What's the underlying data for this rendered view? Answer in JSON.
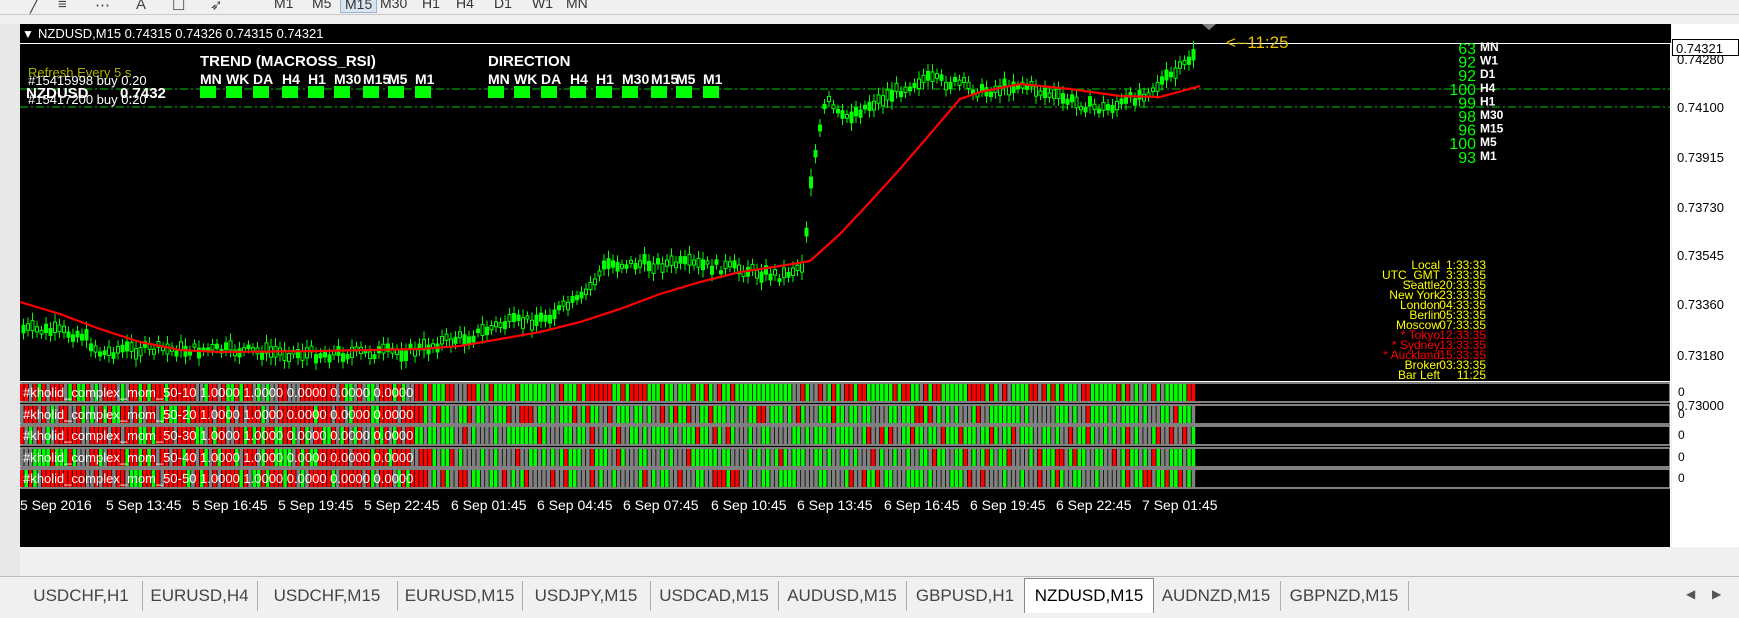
{
  "toolbar": {
    "timeframes": [
      "M1",
      "M5",
      "M15",
      "M30",
      "H1",
      "H4",
      "D1",
      "W1",
      "MN"
    ],
    "active_timeframe": "M15",
    "tool_icons": [
      "line-tool-icon",
      "fibonacci-tool-icon",
      "text-tool-icon",
      "label-tool-icon",
      "arrows-tool-icon"
    ]
  },
  "chart": {
    "header": "NZDUSD,M15  0.74315 0.74326 0.74315 0.74321",
    "current_price": "0.74321",
    "countdown": "<--11:25",
    "overlay": {
      "refresh_text": "Refresh Every 5 s",
      "order1": "#15415998 buy 0.20",
      "order2": "#15417200 buy 0.20",
      "symbol_label": "NZDUSD",
      "symbol_price": "0.7432",
      "trend_title": "TREND (MACROSS_RSI)",
      "direction_title": "DIRECTION",
      "tf_labels": [
        "MN",
        "WK",
        "DA",
        "H4",
        "H1",
        "M30",
        "M15",
        "M5",
        "M1"
      ]
    },
    "strength": [
      {
        "tf": "MN",
        "value": "63"
      },
      {
        "tf": "W1",
        "value": "92"
      },
      {
        "tf": "D1",
        "value": "92"
      },
      {
        "tf": "H4",
        "value": "100"
      },
      {
        "tf": "H1",
        "value": "99"
      },
      {
        "tf": "M30",
        "value": "98"
      },
      {
        "tf": "M15",
        "value": "96"
      },
      {
        "tf": "M5",
        "value": "100"
      },
      {
        "tf": "M1",
        "value": "93"
      }
    ],
    "clocks": [
      {
        "label": "Local",
        "time": "1:33:33",
        "color": "#ffff00"
      },
      {
        "label": "UTC_GMT",
        "time": "3:33:35",
        "color": "#ffff00"
      },
      {
        "label": "Seattle",
        "time": "20:33:35",
        "color": "#ffff00"
      },
      {
        "label": "New York",
        "time": "23:33:35",
        "color": "#ffff00"
      },
      {
        "label": "London",
        "time": "04:33:35",
        "color": "#ffff00"
      },
      {
        "label": "Berlin",
        "time": "05:33:35",
        "color": "#ffff00"
      },
      {
        "label": "Moscow",
        "time": "07:33:35",
        "color": "#ffff00"
      },
      {
        "label": "* Tokyo",
        "time": "12:33:35",
        "color": "#ff0000"
      },
      {
        "label": "* Sydney",
        "time": "13:33:35",
        "color": "#ff0000"
      },
      {
        "label": "* Auckland",
        "time": "15:33:35",
        "color": "#ff0000"
      },
      {
        "label": "Broker",
        "time": "03:33:35",
        "color": "#ffff00"
      },
      {
        "label": "Bar Left",
        "time": "11:25",
        "color": "#ffff00"
      }
    ],
    "price_scale": [
      "0.74280",
      "0.74100",
      "0.73915",
      "0.73730",
      "0.73545",
      "0.73360",
      "0.73180",
      "0.73000"
    ],
    "time_labels": [
      "5 Sep 2016",
      "5 Sep 13:45",
      "5 Sep 16:45",
      "5 Sep 19:45",
      "5 Sep 22:45",
      "6 Sep 01:45",
      "6 Sep 04:45",
      "6 Sep 07:45",
      "6 Sep 10:45",
      "6 Sep 13:45",
      "6 Sep 16:45",
      "6 Sep 19:45",
      "6 Sep 22:45",
      "7 Sep 01:45"
    ],
    "indicators": [
      {
        "label": "#kholid_complex_mom_50-10 1.0000 1.0000 0.0000 0.0000 0.0000",
        "scale": "0"
      },
      {
        "label": "#kholid_complex_mom_50-20 1.0000 1.0000 0.0000 0.0000 0.0000",
        "scale": "0"
      },
      {
        "label": "#kholid_complex_mom_50-30 1.0000 1.0000 0.0000 0.0000 0.0000",
        "scale": "0"
      },
      {
        "label": "#kholid_complex_mom_50-40 1.0000 1.0000 0.0000 0.0000 0.0000",
        "scale": "0"
      },
      {
        "label": "#kholid_complex_mom_50-50 1.0000 1.0000 0.0000 0.0000 0.0000",
        "scale": "0"
      }
    ],
    "colors": {
      "bull": "#00ff00",
      "bear": "#ff0000",
      "neutral": "#808080",
      "ma": "#ff0000",
      "candle": "#00ff00"
    }
  },
  "tabs": {
    "items": [
      "USDCHF,H1",
      "EURUSD,H4",
      "USDCHF,M15",
      "EURUSD,M15",
      "USDJPY,M15",
      "USDCAD,M15",
      "AUDUSD,M15",
      "GBPUSD,H1",
      "NZDUSD,M15",
      "AUDNZD,M15",
      "GBPNZD,M15"
    ],
    "active": "NZDUSD,M15"
  }
}
